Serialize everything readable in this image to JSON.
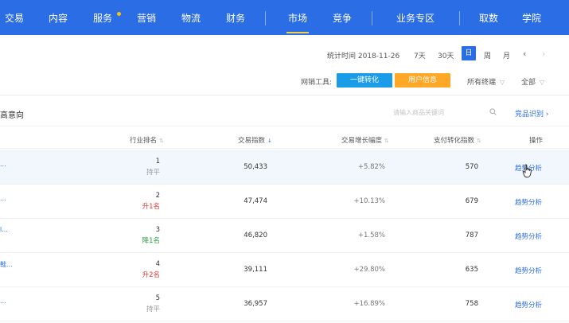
{
  "colors": {
    "nav_bg": "#2b6de5",
    "nav_active_underline": "#f7d046",
    "link": "#2b6de5",
    "tool_primary": "#1a9ce8",
    "tool_secondary": "#ffa726",
    "flat": "#999999",
    "up": "#e53935",
    "down": "#2e9e3f"
  },
  "nav": {
    "items": [
      "交易",
      "内容",
      "服务",
      "营销",
      "物流",
      "财务",
      "市场",
      "竞争",
      "业务专区",
      "取数",
      "学院"
    ],
    "active": "市场"
  },
  "toolbar": {
    "stat_time": "统计时间 2018-11-26",
    "ranges": [
      "7天",
      "30天",
      "日",
      "周",
      "月"
    ],
    "selected_range": "日",
    "prev_icon": "‹",
    "next_icon": "›"
  },
  "tools": {
    "label": "网销工具:",
    "one_click": "一键转化",
    "user_info": "用户信息",
    "terminal": "所有终端",
    "scope": "全部"
  },
  "section": {
    "title_visible": "高意向",
    "search_placeholder": "请输入商品关键词",
    "identify_link": "竞品识别"
  },
  "table": {
    "headers": {
      "rank": "行业排名",
      "trade_index": "交易指数",
      "trade_growth": "交易增长幅度",
      "pay_index": "支付转化指数",
      "action": "操作"
    },
    "rows": [
      {
        "stub": "...",
        "rank": "1",
        "trend": "持平",
        "trend_type": "flat",
        "trade_index": "50,433",
        "growth": "+5.82%",
        "pay_index": "570",
        "action": "趋势分析"
      },
      {
        "stub": "...",
        "rank": "2",
        "trend": "升1名",
        "trend_type": "up",
        "trade_index": "47,474",
        "growth": "+10.13%",
        "pay_index": "679",
        "action": "趋势分析"
      },
      {
        "stub": "l...",
        "rank": "3",
        "trend": "降1名",
        "trend_type": "down",
        "trade_index": "46,820",
        "growth": "+1.58%",
        "pay_index": "787",
        "action": "趋势分析"
      },
      {
        "stub": "鞋...",
        "rank": "4",
        "trend": "升2名",
        "trend_type": "up",
        "trade_index": "39,111",
        "growth": "+29.80%",
        "pay_index": "635",
        "action": "趋势分析"
      },
      {
        "stub": "...",
        "rank": "5",
        "trend": "持平",
        "trend_type": "flat",
        "trade_index": "36,957",
        "growth": "+16.89%",
        "pay_index": "758",
        "action": "趋势分析"
      }
    ]
  }
}
